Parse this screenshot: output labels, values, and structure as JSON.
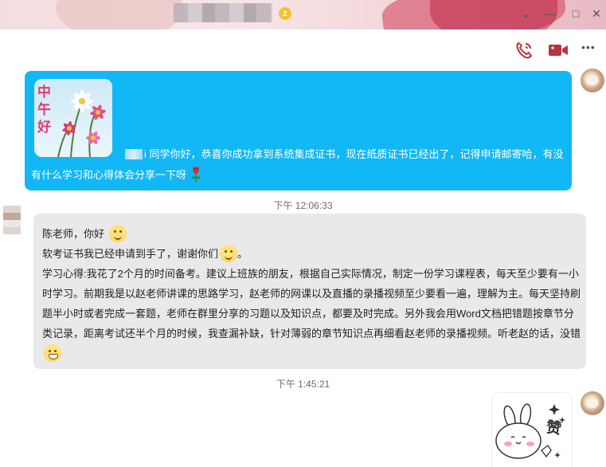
{
  "window": {
    "contact_badge": "z",
    "minimize_glyph": "—",
    "maximize_glyph": "□",
    "close_glyph": "✕",
    "dropdown_glyph": "⌄"
  },
  "header": {
    "icons": [
      "phone-icon",
      "video-call-icon",
      "more-icon"
    ],
    "more_glyph": "•••"
  },
  "messages": [
    {
      "side": "right",
      "sticker_text": "中午好",
      "text": "同学你好，恭喜你成功拿到系统集成证书，现在纸质证书已经出了，记得申请邮寄哈，有没有什么学习和心得体会分享一下呀",
      "trailing_prefix": "i"
    },
    {
      "side": "left",
      "timestamp": "下午 12:06:33",
      "line1": "陈老师，你好",
      "line2": "软考证书我已经申请到手了，谢谢你们",
      "line2_end": "。",
      "body": "学习心得:我花了2个月的时间备考。建议上班族的朋友，根据自己实际情况，制定一份学习课程表，每天至少要有一小时学习。前期我是以赵老师讲课的思路学习，赵老师的网课以及直播的录播视频至少要看一遍，理解为主。每天坚持刷题半小时或者完成一套题，老师在群里分享的习题以及知识点，都要及时完成。另外我会用Word文档把错题按章节分类记录，距离考试还半个月的时候，我查漏补缺，针对薄弱的章节知识点再细看赵老师的录播视频。听老赵的话，没错"
    },
    {
      "side": "right",
      "timestamp": "下午 1:45:21",
      "sticker_text": "赞"
    }
  ],
  "colors": {
    "bubble_blue": "#12b7f5",
    "bubble_gray": "#e9e9e9",
    "icon_red": "#b8343f"
  }
}
